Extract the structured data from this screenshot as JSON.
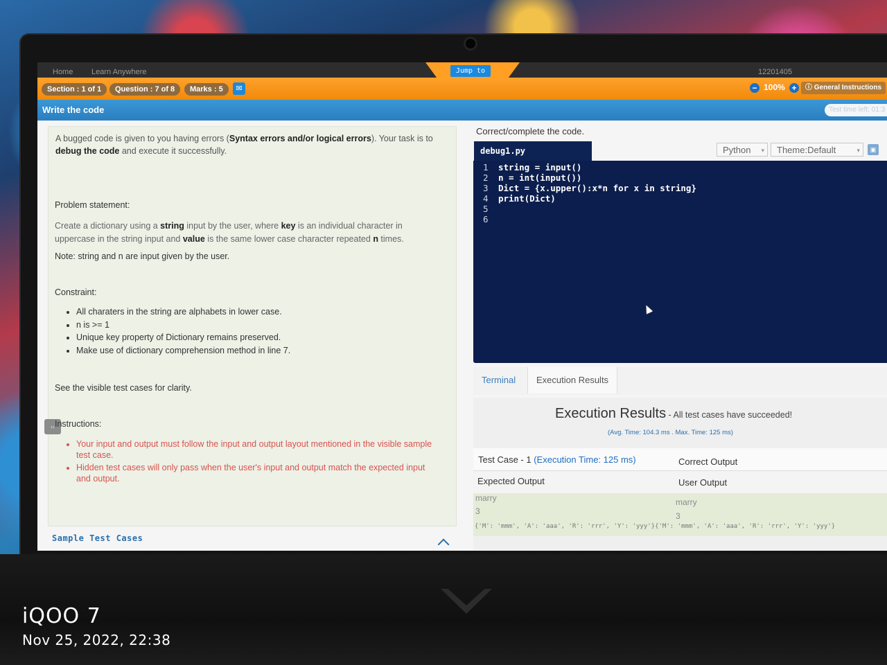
{
  "header": {
    "breadcrumb_home": "Home",
    "breadcrumb_learn": "Learn Anywhere",
    "user_id": "12201405",
    "jump_to": "Jump to",
    "section": "Section : 1 of 1",
    "question": "Question : 7 of 8",
    "marks": "Marks : 5",
    "zoom_minus": "−",
    "zoom": "100%",
    "zoom_plus": "+",
    "general_instructions": "General Instructions",
    "write_code": "Write the code",
    "time_left": "Test time left: 01:3"
  },
  "problem": {
    "intro_1": "A bugged code is given to you having errors (",
    "intro_bold_1": "Syntax errors and/or logical errors",
    "intro_2": "). Your task is to",
    "intro_bold_2": "debug the code",
    "intro_3": "and execute it successfully.",
    "statement_heading": "Problem statement:",
    "statement_1": "Create a dictionary using a ",
    "statement_string": "string",
    "statement_2": " input by the user, where ",
    "statement_key": "key",
    "statement_3": " is an individual character in",
    "statement_4": "uppercase in the string input and ",
    "statement_value": "value",
    "statement_5": " is the same lower case character repeated ",
    "statement_n": "n",
    "statement_6": " times.",
    "note": "Note: string and n are input given by the user.",
    "constraint_heading": "Constraint:",
    "constraints": [
      "All charaters in the string are alphabets in lower case.",
      "n is >= 1",
      "Unique key property of Dictionary remains preserved.",
      "Make use of dictionary comprehension method in line 7."
    ],
    "see_visible": "See the visible test cases for clarity.",
    "instructions_heading": "Instructions:",
    "instructions": [
      "Your input and output must follow the input and output layout mentioned in the visible sample test case.",
      "Hidden test cases will only pass when the user's input and output match the expected input and output."
    ],
    "sample_test_cases": "Sample Test Cases"
  },
  "editor": {
    "prompt": "Correct/complete the code.",
    "filename": "debug1.py",
    "language": "Python",
    "theme": "Theme:Default",
    "lines": [
      {
        "n": "1",
        "code": "string = input()"
      },
      {
        "n": "2",
        "code": "n = int(input())"
      },
      {
        "n": "3",
        "code": "Dict = {x.upper():x*n for x in string}"
      },
      {
        "n": "4",
        "code": "print(Dict)"
      },
      {
        "n": "5",
        "code": ""
      },
      {
        "n": "6",
        "code": ""
      }
    ]
  },
  "results": {
    "tab_terminal": "Terminal",
    "tab_execution": "Execution Results",
    "title": "Execution Results",
    "status": " - All test cases have succeeded!",
    "avg": "(Avg. Time: 104.3 ms . Max. Time: 125 ms)",
    "test_case": "Test Case - 1",
    "exec_time": "(Execution Time: 125 ms)",
    "correct_output": "Correct Output",
    "expected_output": "Expected Output",
    "user_output": "User Output",
    "expected_line1": "marry",
    "expected_line2": "3",
    "user_line1": "marry",
    "user_line2": "3",
    "output_dict": "{'M': 'mmm', 'A': 'aaa', 'R': 'rrr', 'Y': 'yyy'}{'M': 'mmm', 'A': 'aaa', 'R': 'rrr', 'Y': 'yyy'}"
  },
  "watermark": {
    "brand": "iQOO 7",
    "datetime": "Nov 25, 2022, 22:38"
  }
}
